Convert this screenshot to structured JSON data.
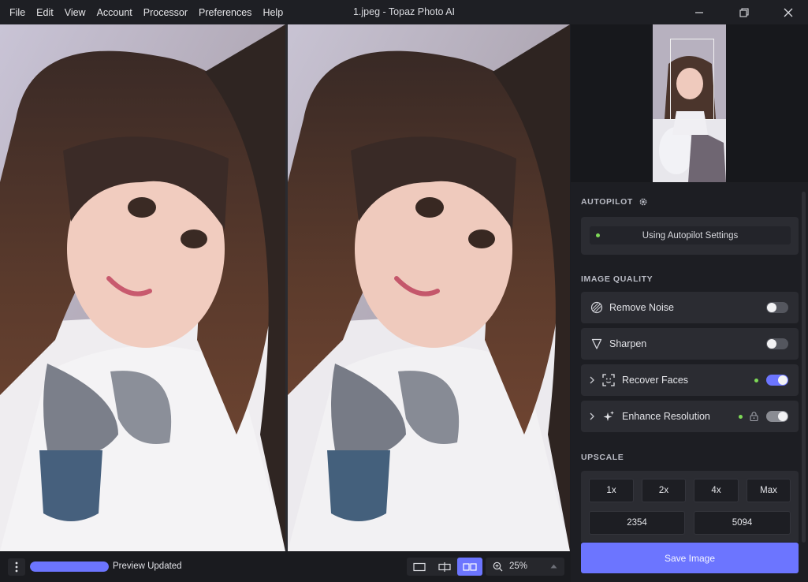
{
  "menu": [
    "File",
    "Edit",
    "View",
    "Account",
    "Processor",
    "Preferences",
    "Help"
  ],
  "window_title": "1.jpeg - Topaz Photo AI",
  "panel": {
    "autopilot": {
      "heading": "AUTOPILOT",
      "button_label": "Using Autopilot Settings"
    },
    "image_quality": {
      "heading": "IMAGE QUALITY",
      "items": [
        {
          "label": "Remove Noise",
          "icon": "noise-icon",
          "enabled": false
        },
        {
          "label": "Sharpen",
          "icon": "sharpen-icon",
          "enabled": false
        },
        {
          "label": "Recover Faces",
          "icon": "face-icon",
          "enabled": true
        },
        {
          "label": "Enhance Resolution",
          "icon": "sparkle-icon",
          "enabled": true,
          "locked": true
        }
      ]
    },
    "upscale": {
      "heading": "UPSCALE",
      "factors": [
        "1x",
        "2x",
        "4x",
        "Max"
      ],
      "width": "2354",
      "height": "5094"
    },
    "save_label": "Save Image"
  },
  "bottom": {
    "status": "Preview Updated",
    "progress": 1.0,
    "zoom": "25%",
    "active_view": "side-by-side"
  },
  "colors": {
    "accent": "#6c75ff",
    "status_green": "#7ed957",
    "panel_bg": "#1d1e23",
    "card_bg": "#2b2c32"
  }
}
